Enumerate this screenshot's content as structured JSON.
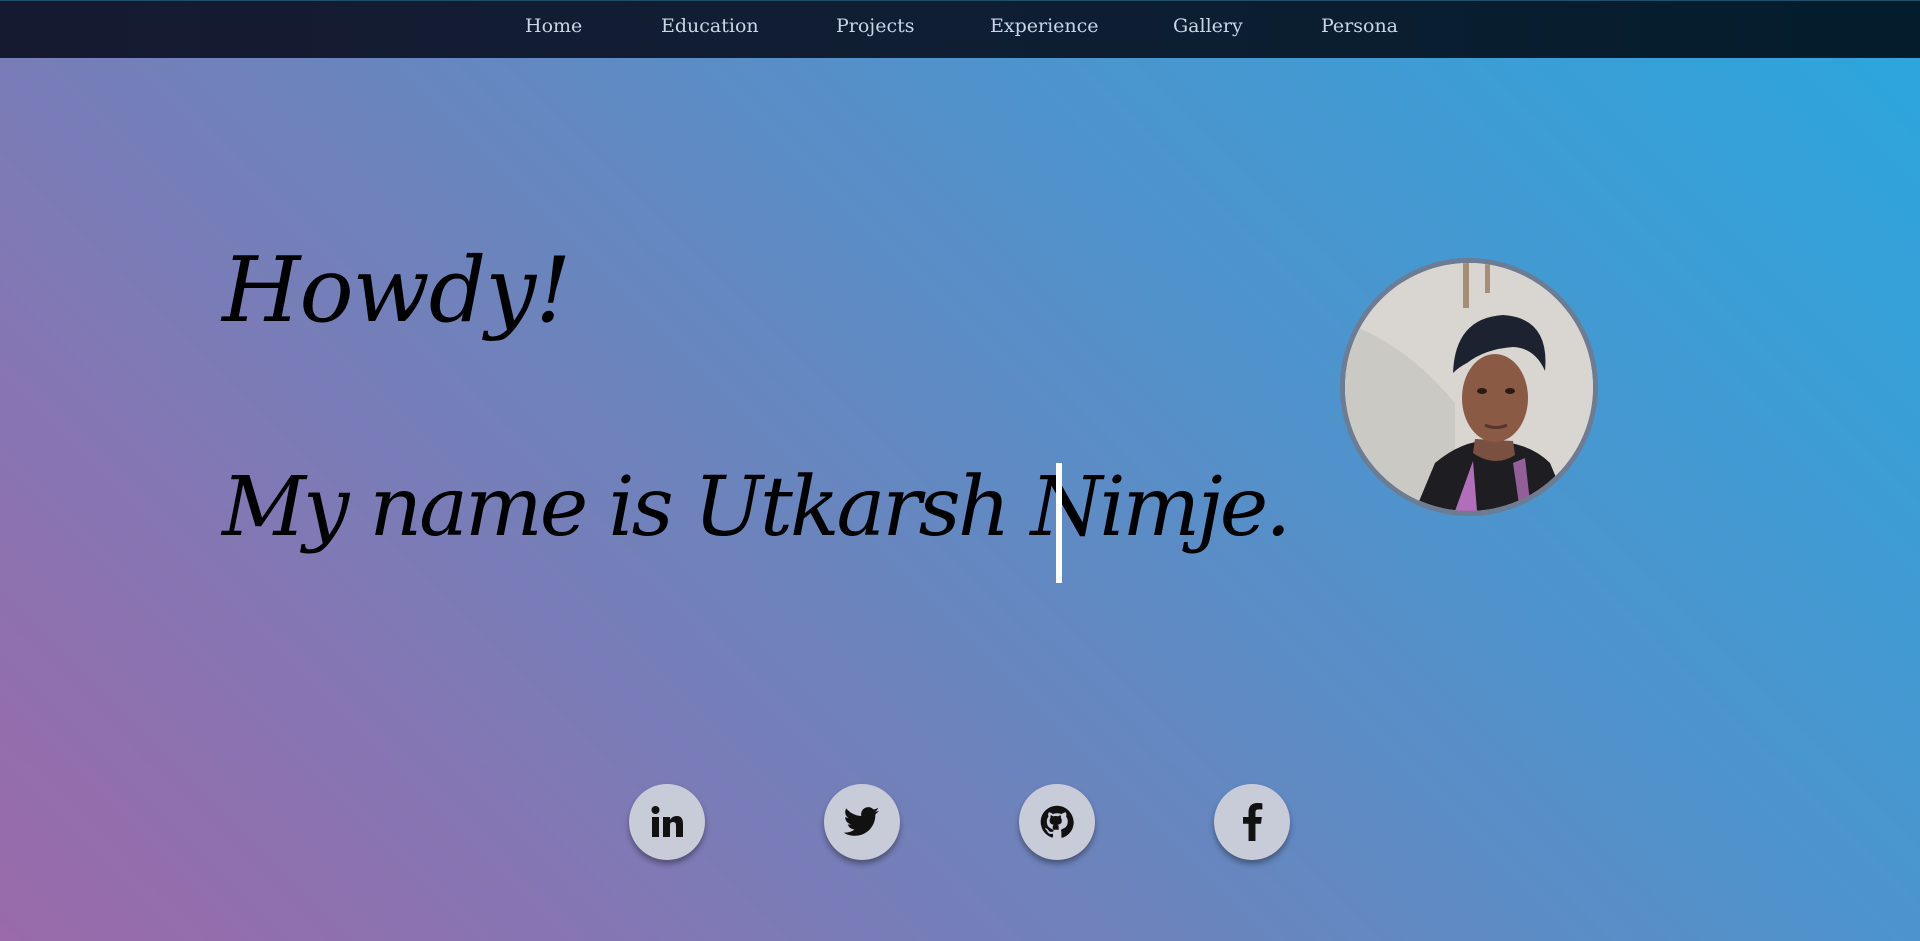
{
  "nav": {
    "items": [
      {
        "label": "Home"
      },
      {
        "label": "Education"
      },
      {
        "label": "Projects"
      },
      {
        "label": "Experience"
      },
      {
        "label": "Gallery"
      },
      {
        "label": "Persona"
      }
    ]
  },
  "hero": {
    "greeting": "Howdy!",
    "intro": "My name is Utkarsh Nimje."
  },
  "social": [
    {
      "name": "linkedin",
      "icon": "linkedin-icon"
    },
    {
      "name": "twitter",
      "icon": "twitter-icon"
    },
    {
      "name": "github",
      "icon": "github-icon"
    },
    {
      "name": "facebook",
      "icon": "facebook-icon"
    }
  ],
  "colors": {
    "navbar": "#0f1e33",
    "nav_text": "#c9d6e6",
    "gradient_start": "#2aa7de",
    "gradient_end": "#9a6aaa",
    "social_button": "#c8cbd8"
  }
}
